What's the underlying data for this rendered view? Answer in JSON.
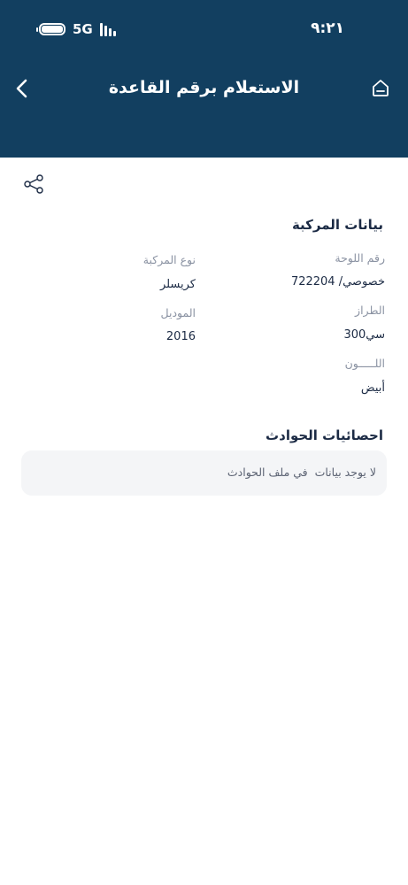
{
  "status_bar": {
    "time": "٩:٢١",
    "network": "5G"
  },
  "nav": {
    "title": "الاستعلام برقم القاعدة"
  },
  "vehicle": {
    "title": "بيانات المركبة",
    "plate_label": "رقم اللوحة",
    "plate_value": "خصوصي/ 722204",
    "type_label": "نوع المركبة",
    "type_value": "كريسلر",
    "model_label": "الطراز",
    "model_value": "سي300",
    "year_label": "الموديل",
    "year_value": "2016",
    "color_label": "اللـــــون",
    "color_value": "أبيض"
  },
  "accidents": {
    "title": "احصائيات الحوادث",
    "empty_message": "لا يوجد بيانات  في ملف الحوادث"
  }
}
